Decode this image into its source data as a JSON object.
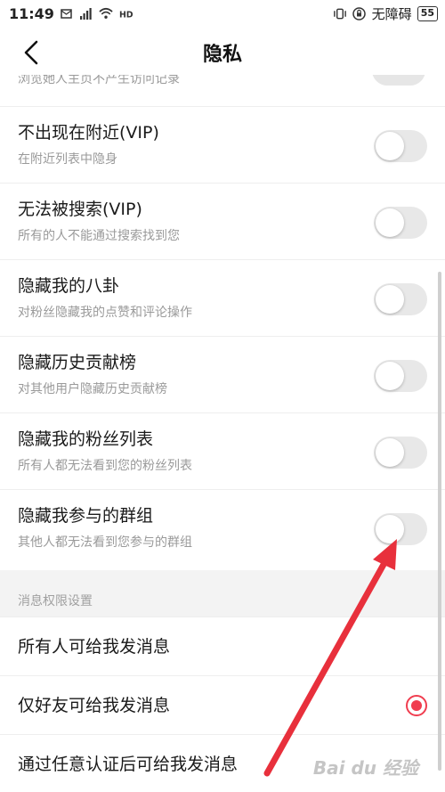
{
  "status_bar": {
    "time": "11:49",
    "network_label": "无障碍",
    "battery": "55"
  },
  "nav": {
    "title": "隐私"
  },
  "truncated_row": {
    "subtitle": "浏览她人主页不产生访问记录"
  },
  "privacy_items": [
    {
      "title": "不出现在附近(VIP)",
      "subtitle": "在附近列表中隐身",
      "enabled": false
    },
    {
      "title": "无法被搜索(VIP)",
      "subtitle": "所有的人不能通过搜索找到您",
      "enabled": false
    },
    {
      "title": "隐藏我的八卦",
      "subtitle": "对粉丝隐藏我的点赞和评论操作",
      "enabled": false
    },
    {
      "title": "隐藏历史贡献榜",
      "subtitle": "对其他用户隐藏历史贡献榜",
      "enabled": false
    },
    {
      "title": "隐藏我的粉丝列表",
      "subtitle": "所有人都无法看到您的粉丝列表",
      "enabled": false
    },
    {
      "title": "隐藏我参与的群组",
      "subtitle": "其他人都无法看到您参与的群组",
      "enabled": false
    }
  ],
  "message_section": {
    "header": "消息权限设置",
    "options": [
      {
        "label": "所有人可给我发消息",
        "selected": false
      },
      {
        "label": "仅好友可给我发消息",
        "selected": true
      },
      {
        "label": "通过任意认证后可给我发消息",
        "selected": false
      }
    ]
  },
  "watermark": "Bai du 经验",
  "colors": {
    "accent": "#f03d4f",
    "toggle_off": "#e8e8e8",
    "arrow": "#e8303c"
  }
}
